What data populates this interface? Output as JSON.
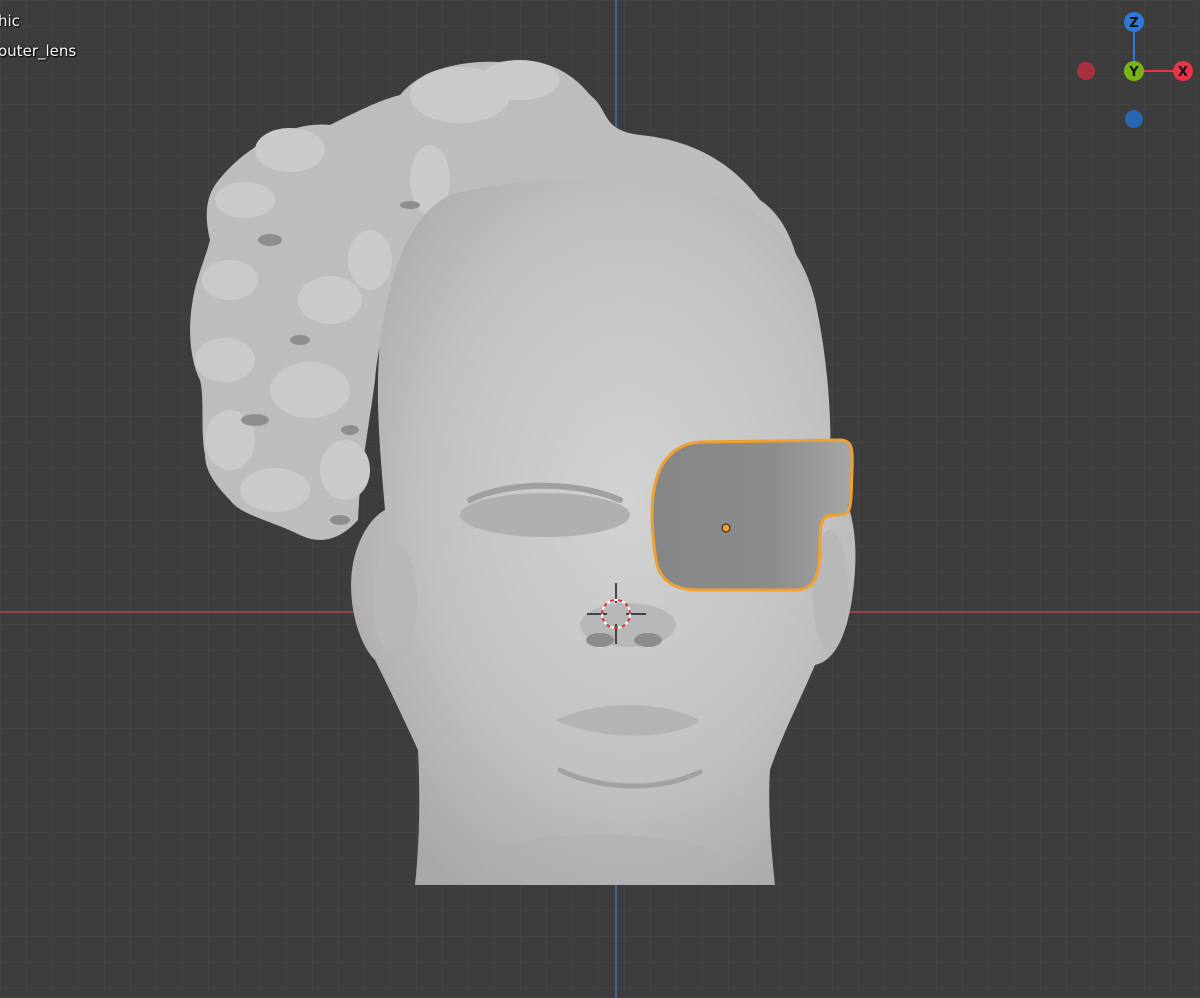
{
  "viewport": {
    "view_label": "hic",
    "object_label": "outer_lens"
  },
  "gizmo": {
    "z_label": "Z",
    "y_label": "Y",
    "x_label": "X",
    "colors": {
      "z": "#2e7ad6",
      "y": "#7ab318",
      "x": "#e8344a",
      "neg_x": "#a6323f",
      "neg_z": "#2a66b0"
    }
  },
  "colors": {
    "background": "#3d3d3d",
    "grid_minor": "#484848",
    "grid_major": "#4f4f4f",
    "axis_x": "#b4434f",
    "axis_z": "#3f73b0",
    "mesh": "#c4c4c4",
    "selection_outline": "#f0a030",
    "lens_fill": "#8a8a8a"
  }
}
